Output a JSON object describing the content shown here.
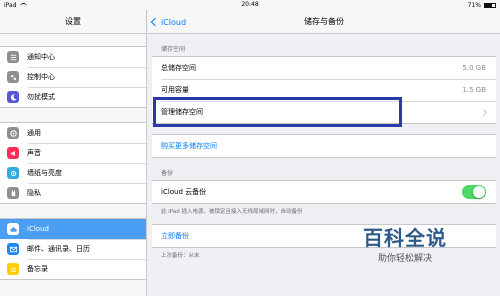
{
  "status": {
    "device": "iPad",
    "time": "20:48",
    "battery": "71%"
  },
  "sidebar": {
    "title": "设置",
    "group1": [
      {
        "label": "通知中心",
        "icon": "notifications-icon",
        "color": "#8e8e93"
      },
      {
        "label": "控制中心",
        "icon": "control-center-icon",
        "color": "#8e8e93"
      },
      {
        "label": "勿扰模式",
        "icon": "moon-icon",
        "color": "#5856d6"
      }
    ],
    "group2": [
      {
        "label": "通用",
        "icon": "gear-icon",
        "color": "#8e8e93"
      },
      {
        "label": "声音",
        "icon": "speaker-icon",
        "color": "#ff2d55"
      },
      {
        "label": "墙纸与亮度",
        "icon": "wallpaper-icon",
        "color": "#34aadc"
      },
      {
        "label": "隐私",
        "icon": "hand-icon",
        "color": "#8e8e93"
      }
    ],
    "group3": [
      {
        "label": "iCloud",
        "icon": "cloud-icon",
        "color": "#ffffff",
        "selected": true
      },
      {
        "label": "邮件、通讯录、日历",
        "icon": "mail-icon",
        "color": "#1e88f5"
      },
      {
        "label": "备忘录",
        "icon": "notes-icon",
        "color": "#ffcc00"
      }
    ]
  },
  "nav": {
    "back_label": "iCloud",
    "title": "储存与备份"
  },
  "storage": {
    "section_title": "储存空间",
    "total_label": "总储存空间",
    "total_value": "5.0 GB",
    "available_label": "可用容量",
    "available_value": "1.5 GB",
    "manage_label": "管理储存空间",
    "buy_label": "购买更多储存空间"
  },
  "backup": {
    "section_title": "备份",
    "icloud_backup_label": "iCloud 云备份",
    "icloud_backup_on": true,
    "footnote": "此 iPad 插入电源、被锁定且接入无线局域网时，自动备份",
    "backup_now_label": "立即备份",
    "last_backup": "上次备份：从未"
  },
  "watermark": {
    "main": "百科全说",
    "sub": "助你轻松解决"
  }
}
